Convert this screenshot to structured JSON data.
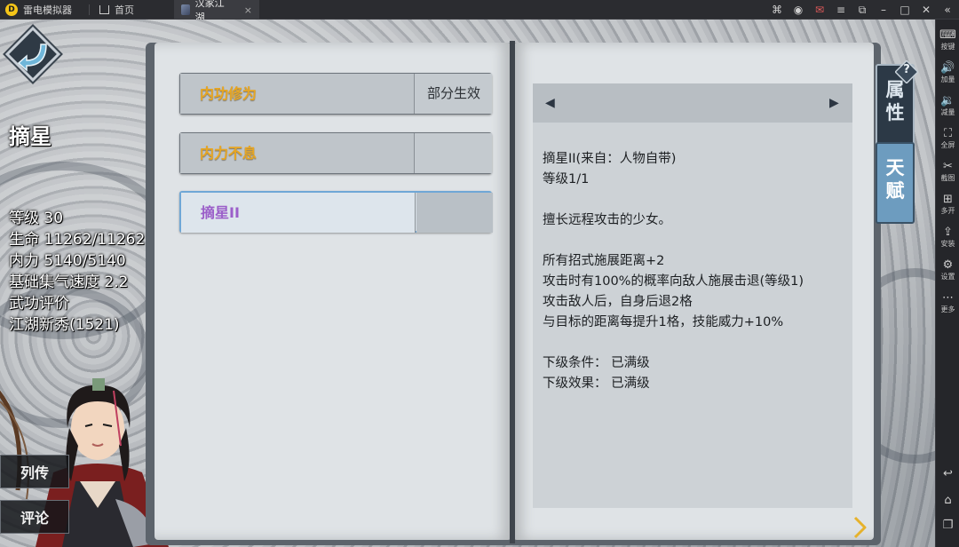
{
  "titlebar": {
    "brand": "雷电模拟器",
    "logo_glyph": "D",
    "tabs": [
      {
        "label": "首页",
        "icon": "home-icon"
      },
      {
        "label": "汉家江湖",
        "icon": "game-icon",
        "close": "×"
      }
    ],
    "controls": [
      {
        "name": "gamepad-icon",
        "glyph": "⌘"
      },
      {
        "name": "user-icon",
        "glyph": "◉"
      },
      {
        "name": "mail-icon",
        "glyph": "✉"
      },
      {
        "name": "settings-icon",
        "glyph": "≡"
      },
      {
        "name": "resize-icon",
        "glyph": "⧉"
      },
      {
        "name": "minimize-icon",
        "glyph": "–"
      },
      {
        "name": "maximize-icon",
        "glyph": "□"
      },
      {
        "name": "close-icon",
        "glyph": "✕"
      },
      {
        "name": "collapse-icon",
        "glyph": "«"
      }
    ]
  },
  "sidebar": {
    "items": [
      {
        "label": "按键",
        "glyph": "⌨",
        "icon": "keyboard-icon"
      },
      {
        "label": "加量",
        "glyph": "🔊",
        "icon": "volume-up-icon"
      },
      {
        "label": "减量",
        "glyph": "🔉",
        "icon": "volume-down-icon"
      },
      {
        "label": "全屏",
        "glyph": "⛶",
        "icon": "fullscreen-icon"
      },
      {
        "label": "截图",
        "glyph": "✂",
        "icon": "screenshot-icon"
      },
      {
        "label": "多开",
        "glyph": "⊞",
        "icon": "multi-instance-icon"
      },
      {
        "label": "安装",
        "glyph": "⇪",
        "icon": "install-apk-icon"
      },
      {
        "label": "设置",
        "glyph": "⚙",
        "icon": "settings-gear-icon"
      },
      {
        "label": "更多",
        "glyph": "⋯",
        "icon": "more-icon"
      }
    ],
    "nav": [
      {
        "glyph": "↩",
        "icon": "back-nav-icon"
      },
      {
        "glyph": "⌂",
        "icon": "home-nav-icon"
      },
      {
        "glyph": "❐",
        "icon": "recent-apps-icon"
      }
    ]
  },
  "character": {
    "name": "摘星",
    "stats": [
      "等级 30",
      "生命 11262/11262",
      "内力 5140/5140",
      "基础集气速度 2.2",
      "武功评价",
      "江湖新秀(1521)"
    ]
  },
  "left_buttons": [
    {
      "label": "列传"
    },
    {
      "label": "评论"
    }
  ],
  "skills": [
    {
      "name": "内功修为",
      "status": "部分生效",
      "selected": false
    },
    {
      "name": "内力不息",
      "status": "",
      "selected": false
    },
    {
      "name": "摘星II",
      "status": "",
      "selected": true
    }
  ],
  "detail": {
    "prev_glyph": "◀",
    "next_glyph": "▶",
    "lines": [
      "摘星II(来自：人物自带)",
      "等级1/1",
      "",
      "擅长远程攻击的少女。",
      "",
      "所有招式施展距离+2",
      "攻击时有100%的概率向敌人施展击退(等级1)",
      "攻击敌人后，自身后退2格",
      "与目标的距离每提升1格，技能威力+10%",
      "",
      "下级条件： 已满级",
      "下级效果： 已满级"
    ]
  },
  "side_tabs": [
    {
      "label_top": "属",
      "label_bottom": "性"
    },
    {
      "label_top": "天",
      "label_bottom": "赋"
    }
  ],
  "help_glyph": "?",
  "colors": {
    "skill_name_gold": "#e7a623",
    "skill_selected_purple": "#9b5fc9",
    "selected_border": "#6fa7d6"
  }
}
